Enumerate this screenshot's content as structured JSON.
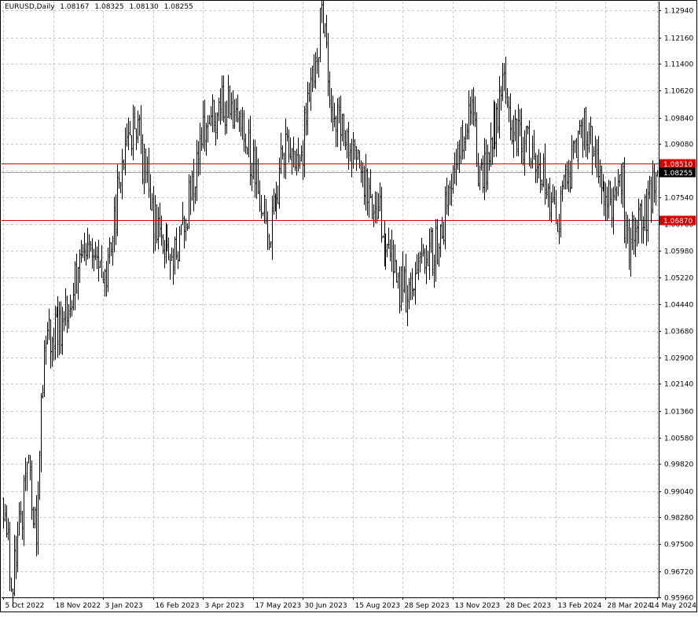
{
  "header": {
    "symbol": "EURUSD,Daily",
    "open": "1.08167",
    "high": "1.08325",
    "low": "1.08130",
    "close": "1.08255"
  },
  "colors": {
    "background": "#ffffff",
    "bars": "#000000",
    "grid": "#c8c8c8",
    "level_line": "#d40000",
    "level_label_bg": "#d40000",
    "current_label_bg": "#000000"
  },
  "chart_data": {
    "type": "ohlc",
    "ylim": [
      0.9596,
      1.132
    ],
    "grid": true,
    "y_ticks": [
      "1.12940",
      "1.12160",
      "1.11400",
      "1.10620",
      "1.09840",
      "1.09080",
      "1.08300",
      "1.07540",
      "1.06760",
      "1.05980",
      "1.05220",
      "1.04440",
      "1.03680",
      "1.02900",
      "1.02140",
      "1.01360",
      "1.00580",
      "0.99820",
      "0.99040",
      "0.98280",
      "0.97500",
      "0.96720",
      "0.95960"
    ],
    "x_tick_labels": [
      "5 Oct 2022",
      "18 Nov 2022",
      "3 Jan 2023",
      "16 Feb 2023",
      "3 Apr 2023",
      "17 May 2023",
      "30 Jun 2023",
      "15 Aug 2023",
      "28 Sep 2023",
      "13 Nov 2023",
      "28 Dec 2023",
      "13 Feb 2024",
      "28 Mar 2024",
      "14 May 2024"
    ],
    "price_path": [
      [
        "5 Oct 2022",
        0.988
      ],
      [
        "13 Oct 2022",
        0.965
      ],
      [
        "28 Oct 2022",
        0.998
      ],
      [
        "3 Nov 2022",
        0.976
      ],
      [
        "11 Nov 2022",
        1.034
      ],
      [
        "30 Nov 2022",
        1.04
      ],
      [
        "15 Dec 2022",
        1.063
      ],
      [
        "6 Jan 2023",
        1.053
      ],
      [
        "20 Jan 2023",
        1.086
      ],
      [
        "1 Feb 2023",
        1.098
      ],
      [
        "15 Feb 2023",
        1.07
      ],
      [
        "6 Mar 2023",
        1.056
      ],
      [
        "20 Mar 2023",
        1.072
      ],
      [
        "5 Apr 2023",
        1.098
      ],
      [
        "26 Apr 2023",
        1.103
      ],
      [
        "10 May 2023",
        1.092
      ],
      [
        "31 May 2023",
        1.066
      ],
      [
        "15 Jun 2023",
        1.09
      ],
      [
        "30 Jun 2023",
        1.09
      ],
      [
        "18 Jul 2023",
        1.126
      ],
      [
        "27 Jul 2023",
        1.098
      ],
      [
        "10 Aug 2023",
        1.093
      ],
      [
        "24 Aug 2023",
        1.081
      ],
      [
        "7 Sep 2023",
        1.07
      ],
      [
        "26 Sep 2023",
        1.05
      ],
      [
        "3 Oct 2023",
        1.047
      ],
      [
        "20 Oct 2023",
        1.059
      ],
      [
        "31 Oct 2023",
        1.062
      ],
      [
        "15 Nov 2023",
        1.087
      ],
      [
        "29 Nov 2023",
        1.098
      ],
      [
        "8 Dec 2023",
        1.078
      ],
      [
        "28 Dec 2023",
        1.108
      ],
      [
        "5 Jan 2024",
        1.094
      ],
      [
        "19 Jan 2024",
        1.09
      ],
      [
        "14 Feb 2024",
        1.07
      ],
      [
        "8 Mar 2024",
        1.095
      ],
      [
        "20 Mar 2024",
        1.086
      ],
      [
        "2 Apr 2024",
        1.074
      ],
      [
        "12 Apr 2024",
        1.08
      ],
      [
        "16 Apr 2024",
        1.062
      ],
      [
        "2 May 2024",
        1.07
      ],
      [
        "14 May 2024",
        1.0826
      ]
    ],
    "bar_seed": 12,
    "levels": [
      {
        "value": 1.0851,
        "label": "1.08510",
        "kind": "resistance"
      },
      {
        "value": 1.0687,
        "label": "1.06870",
        "kind": "support"
      }
    ],
    "current_price": {
      "value": 1.08255,
      "label": "1.08255"
    }
  }
}
